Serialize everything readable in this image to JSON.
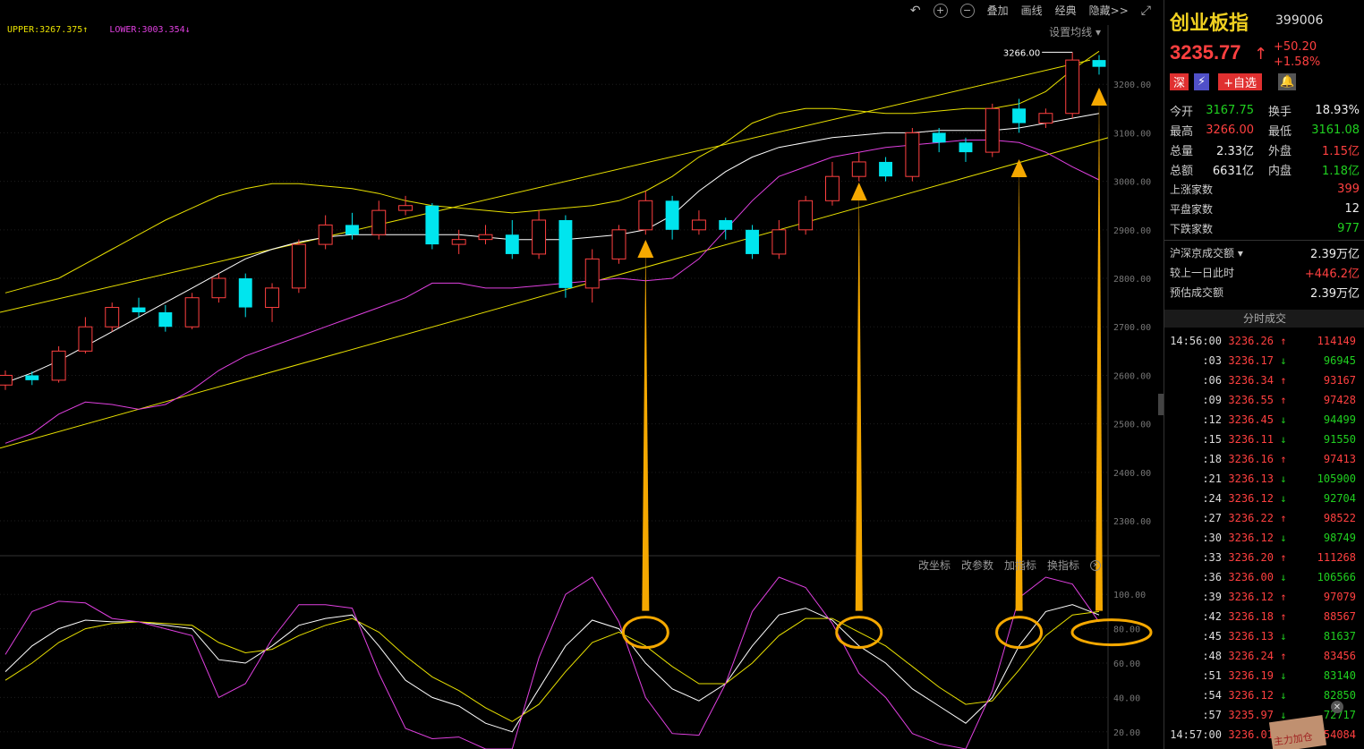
{
  "toolbar": {
    "undo_icon": "undo-icon",
    "zoom_in_icon": "zoom-in-icon",
    "zoom_out_icon": "zoom-out-icon",
    "overlay_label": "叠加",
    "draw_label": "画线",
    "classic_label": "经典",
    "hide_label": "隐藏>>",
    "fullscreen_icon": "fullscreen-icon"
  },
  "band_legend": {
    "upper": "UPPER:3267.375↑",
    "lower": "LOWER:3003.354↓"
  },
  "ma_setting_label": "设置均线",
  "high_marker": "3266.00",
  "indicator_toolbar": {
    "change_axis": "改坐标",
    "change_params": "改参数",
    "add_indicator": "加指标",
    "switch_indicator": "换指标"
  },
  "colors": {
    "up": "#ff4040",
    "down": "#00e5ee",
    "upper_band": "#e8e000",
    "mid_band": "#ffffff",
    "lower_band": "#e040e0",
    "arrow": "#f5a800"
  },
  "chart_data": [
    {
      "type": "candlestick",
      "y_axis_ticks": [
        "3200.00",
        "3100.00",
        "3000.00",
        "2900.00",
        "2800.00",
        "2700.00",
        "2600.00",
        "2500.00",
        "2400.00",
        "2300.00"
      ],
      "ylim": [
        2230,
        3300
      ],
      "series": [
        {
          "name": "UPPER",
          "values": [
            2770,
            2785,
            2800,
            2830,
            2860,
            2890,
            2920,
            2945,
            2970,
            2985,
            2995,
            2995,
            2990,
            2985,
            2975,
            2960,
            2950,
            2945,
            2940,
            2935,
            2940,
            2945,
            2950,
            2960,
            2980,
            3010,
            3050,
            3080,
            3120,
            3140,
            3150,
            3150,
            3145,
            3140,
            3140,
            3145,
            3150,
            3150,
            3160,
            3185,
            3230,
            3268
          ]
        },
        {
          "name": "LOWER",
          "values": [
            2460,
            2480,
            2520,
            2545,
            2540,
            2530,
            2540,
            2570,
            2610,
            2640,
            2660,
            2680,
            2700,
            2720,
            2740,
            2760,
            2790,
            2790,
            2780,
            2780,
            2785,
            2790,
            2795,
            2800,
            2795,
            2800,
            2840,
            2900,
            2960,
            3010,
            3030,
            3050,
            3060,
            3070,
            3075,
            3080,
            3085,
            3085,
            3080,
            3060,
            3030,
            3003
          ]
        },
        {
          "name": "MID",
          "values": [
            2585,
            2605,
            2630,
            2660,
            2690,
            2720,
            2750,
            2780,
            2810,
            2840,
            2860,
            2875,
            2885,
            2890,
            2890,
            2890,
            2890,
            2890,
            2885,
            2880,
            2880,
            2880,
            2885,
            2890,
            2900,
            2930,
            2980,
            3020,
            3050,
            3070,
            3080,
            3090,
            3095,
            3100,
            3100,
            3105,
            3105,
            3105,
            3110,
            3120,
            3130,
            3140
          ]
        }
      ],
      "candles": [
        {
          "o": 2580,
          "c": 2600,
          "h": 2610,
          "l": 2570
        },
        {
          "o": 2600,
          "c": 2590,
          "h": 2608,
          "l": 2580
        },
        {
          "o": 2590,
          "c": 2650,
          "h": 2660,
          "l": 2585
        },
        {
          "o": 2650,
          "c": 2700,
          "h": 2720,
          "l": 2645
        },
        {
          "o": 2700,
          "c": 2740,
          "h": 2750,
          "l": 2690
        },
        {
          "o": 2740,
          "c": 2730,
          "h": 2760,
          "l": 2720
        },
        {
          "o": 2730,
          "c": 2700,
          "h": 2745,
          "l": 2690
        },
        {
          "o": 2700,
          "c": 2760,
          "h": 2770,
          "l": 2695
        },
        {
          "o": 2760,
          "c": 2800,
          "h": 2810,
          "l": 2750
        },
        {
          "o": 2800,
          "c": 2740,
          "h": 2810,
          "l": 2720
        },
        {
          "o": 2740,
          "c": 2780,
          "h": 2790,
          "l": 2710
        },
        {
          "o": 2780,
          "c": 2870,
          "h": 2880,
          "l": 2770
        },
        {
          "o": 2870,
          "c": 2910,
          "h": 2930,
          "l": 2860
        },
        {
          "o": 2910,
          "c": 2890,
          "h": 2935,
          "l": 2880
        },
        {
          "o": 2890,
          "c": 2940,
          "h": 2960,
          "l": 2880
        },
        {
          "o": 2940,
          "c": 2950,
          "h": 2970,
          "l": 2930
        },
        {
          "o": 2950,
          "c": 2870,
          "h": 2955,
          "l": 2860
        },
        {
          "o": 2870,
          "c": 2880,
          "h": 2900,
          "l": 2850
        },
        {
          "o": 2880,
          "c": 2890,
          "h": 2910,
          "l": 2870
        },
        {
          "o": 2890,
          "c": 2850,
          "h": 2920,
          "l": 2840
        },
        {
          "o": 2850,
          "c": 2920,
          "h": 2940,
          "l": 2840
        },
        {
          "o": 2920,
          "c": 2780,
          "h": 2930,
          "l": 2760
        },
        {
          "o": 2780,
          "c": 2840,
          "h": 2860,
          "l": 2750
        },
        {
          "o": 2840,
          "c": 2900,
          "h": 2910,
          "l": 2830
        },
        {
          "o": 2900,
          "c": 2960,
          "h": 2980,
          "l": 2890
        },
        {
          "o": 2960,
          "c": 2900,
          "h": 2970,
          "l": 2880
        },
        {
          "o": 2900,
          "c": 2920,
          "h": 2940,
          "l": 2890
        },
        {
          "o": 2920,
          "c": 2900,
          "h": 2925,
          "l": 2880
        },
        {
          "o": 2900,
          "c": 2850,
          "h": 2910,
          "l": 2840
        },
        {
          "o": 2850,
          "c": 2900,
          "h": 2920,
          "l": 2840
        },
        {
          "o": 2900,
          "c": 2960,
          "h": 2970,
          "l": 2890
        },
        {
          "o": 2960,
          "c": 3010,
          "h": 3040,
          "l": 2950
        },
        {
          "o": 3010,
          "c": 3040,
          "h": 3060,
          "l": 3000
        },
        {
          "o": 3040,
          "c": 3010,
          "h": 3050,
          "l": 3000
        },
        {
          "o": 3010,
          "c": 3100,
          "h": 3110,
          "l": 3000
        },
        {
          "o": 3100,
          "c": 3080,
          "h": 3110,
          "l": 3060
        },
        {
          "o": 3080,
          "c": 3060,
          "h": 3090,
          "l": 3040
        },
        {
          "o": 3060,
          "c": 3150,
          "h": 3160,
          "l": 3050
        },
        {
          "o": 3150,
          "c": 3120,
          "h": 3170,
          "l": 3100
        },
        {
          "o": 3120,
          "c": 3140,
          "h": 3150,
          "l": 3110
        },
        {
          "o": 3140,
          "c": 3250,
          "h": 3266,
          "l": 3130
        },
        {
          "o": 3250,
          "c": 3236,
          "h": 3260,
          "l": 3220
        }
      ]
    },
    {
      "type": "line",
      "y_axis_ticks": [
        "100.00",
        "80.00",
        "60.00",
        "40.00",
        "20.00"
      ],
      "ylim": [
        10,
        110
      ],
      "series": [
        {
          "name": "K",
          "values": [
            55,
            70,
            80,
            85,
            84,
            84,
            82,
            80,
            62,
            60,
            70,
            82,
            86,
            88,
            70,
            50,
            40,
            35,
            25,
            20,
            45,
            70,
            85,
            80,
            60,
            45,
            38,
            48,
            70,
            88,
            92,
            85,
            70,
            60,
            45,
            35,
            25,
            40,
            70,
            90,
            94,
            88
          ]
        },
        {
          "name": "D",
          "values": [
            50,
            60,
            72,
            80,
            83,
            84,
            83,
            82,
            72,
            66,
            68,
            76,
            82,
            86,
            78,
            64,
            52,
            44,
            34,
            26,
            36,
            55,
            72,
            78,
            70,
            58,
            48,
            48,
            60,
            76,
            86,
            86,
            78,
            70,
            58,
            46,
            36,
            38,
            56,
            76,
            88,
            90
          ]
        },
        {
          "name": "J",
          "values": [
            65,
            90,
            96,
            95,
            86,
            84,
            80,
            76,
            40,
            48,
            74,
            94,
            94,
            92,
            54,
            22,
            16,
            17,
            7,
            8,
            63,
            100,
            111,
            84,
            40,
            19,
            18,
            48,
            90,
            112,
            104,
            83,
            54,
            40,
            19,
            13,
            3,
            44,
            98,
            118,
            106,
            84
          ]
        }
      ]
    }
  ],
  "stock": {
    "name": "创业板指",
    "code": "399006",
    "price": "3235.77",
    "change": "+50.20",
    "change_pct": "+1.58%",
    "market_badge": "深",
    "flash_badge": "⚡",
    "add_watchlist": "+自选"
  },
  "stats": {
    "open_label": "今开",
    "open": "3167.75",
    "turnover_label": "换手",
    "turnover": "18.93%",
    "high_label": "最高",
    "high": "3266.00",
    "low_label": "最低",
    "low": "3161.08",
    "volume_label": "总量",
    "volume": "2.33亿",
    "outer_label": "外盘",
    "outer": "1.15亿",
    "amount_label": "总额",
    "amount": "6631亿",
    "inner_label": "内盘",
    "inner": "1.18亿",
    "up_count_label": "上涨家数",
    "up_count": "399",
    "flat_count_label": "平盘家数",
    "flat_count": "12",
    "down_count_label": "下跌家数",
    "down_count": "977",
    "sz_sh_label": "沪深京成交额",
    "sz_sh": "2.39万亿",
    "prev_label": "较上一日此时",
    "prev": "+446.2亿",
    "est_label": "预估成交额",
    "est": "2.39万亿"
  },
  "ticks_header": "分时成交",
  "ticks": [
    {
      "t": "14:56:00",
      "p": "3236.26",
      "d": "↑",
      "v": "114149"
    },
    {
      "t": ":03",
      "p": "3236.17",
      "d": "↓",
      "v": "96945"
    },
    {
      "t": ":06",
      "p": "3236.34",
      "d": "↑",
      "v": "93167"
    },
    {
      "t": ":09",
      "p": "3236.55",
      "d": "↑",
      "v": "97428"
    },
    {
      "t": ":12",
      "p": "3236.45",
      "d": "↓",
      "v": "94499"
    },
    {
      "t": ":15",
      "p": "3236.11",
      "d": "↓",
      "v": "91550"
    },
    {
      "t": ":18",
      "p": "3236.16",
      "d": "↑",
      "v": "97413"
    },
    {
      "t": ":21",
      "p": "3236.13",
      "d": "↓",
      "v": "105900"
    },
    {
      "t": ":24",
      "p": "3236.12",
      "d": "↓",
      "v": "92704"
    },
    {
      "t": ":27",
      "p": "3236.22",
      "d": "↑",
      "v": "98522"
    },
    {
      "t": ":30",
      "p": "3236.12",
      "d": "↓",
      "v": "98749"
    },
    {
      "t": ":33",
      "p": "3236.20",
      "d": "↑",
      "v": "111268"
    },
    {
      "t": ":36",
      "p": "3236.00",
      "d": "↓",
      "v": "106566"
    },
    {
      "t": ":39",
      "p": "3236.12",
      "d": "↑",
      "v": "97079"
    },
    {
      "t": ":42",
      "p": "3236.18",
      "d": "↑",
      "v": "88567"
    },
    {
      "t": ":45",
      "p": "3236.13",
      "d": "↓",
      "v": "81637"
    },
    {
      "t": ":48",
      "p": "3236.24",
      "d": "↑",
      "v": "83456"
    },
    {
      "t": ":51",
      "p": "3236.19",
      "d": "↓",
      "v": "83140"
    },
    {
      "t": ":54",
      "p": "3236.12",
      "d": "↓",
      "v": "82850"
    },
    {
      "t": ":57",
      "p": "3235.97",
      "d": "↓",
      "v": "72717"
    },
    {
      "t": "14:57:00",
      "p": "3236.01",
      "d": "↑",
      "v": "54084"
    }
  ],
  "promo_text": "主力加仓"
}
